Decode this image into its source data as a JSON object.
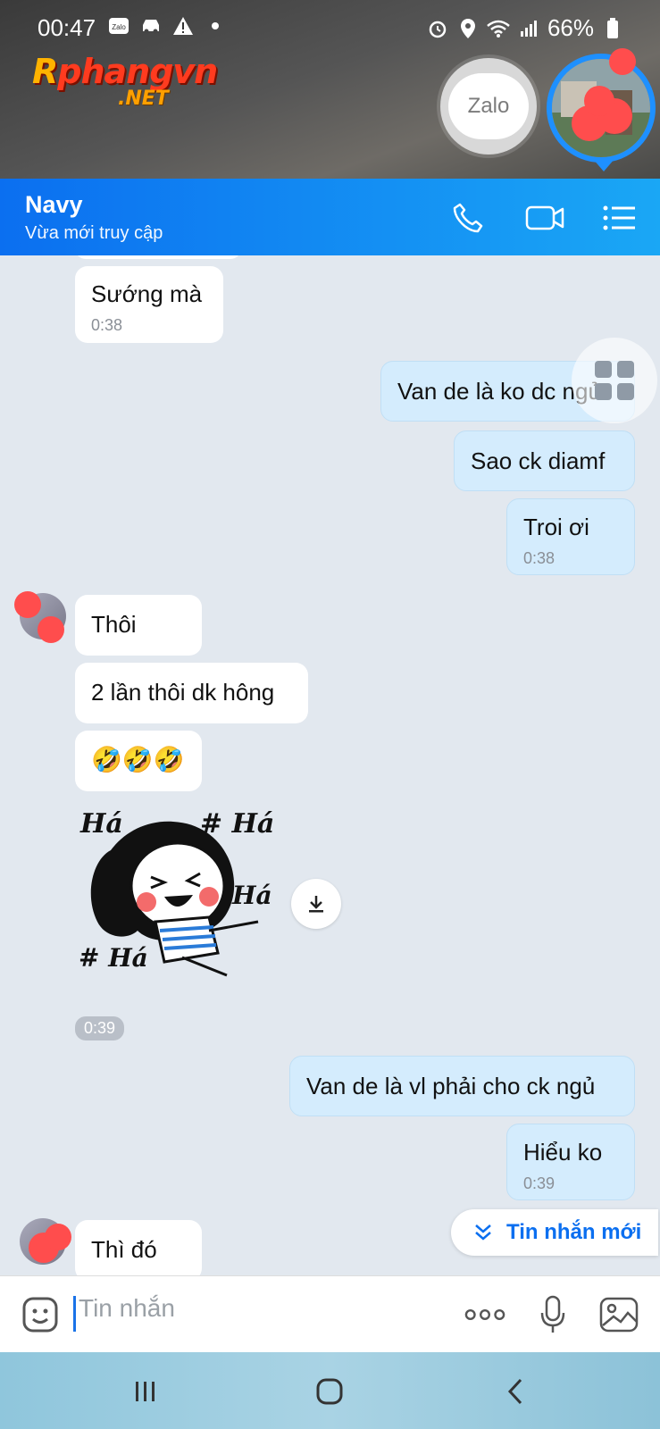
{
  "status_bar": {
    "time": "00:47",
    "battery": "66%",
    "zalo_badge": "Zalo"
  },
  "watermark": {
    "line1a": "R",
    "line1b": "phangvn",
    "line2": ".NET"
  },
  "chat_heads": {
    "zalo_label": "Zalo"
  },
  "header": {
    "name": "Navy",
    "status": "Vừa mới truy cập"
  },
  "messages": [
    {
      "side": "in",
      "text": "Sướng mà",
      "time": "0:38"
    },
    {
      "side": "out",
      "text": "Van de là ko dc ngủ"
    },
    {
      "side": "out",
      "text": "Sao ck diamf"
    },
    {
      "side": "out",
      "text": "Troi ơi",
      "time": "0:38"
    },
    {
      "side": "in",
      "text": "Thôi"
    },
    {
      "side": "in",
      "text": "2 lần thôi dk hông"
    },
    {
      "side": "in",
      "text": "🤣🤣🤣"
    },
    {
      "side": "in",
      "type": "sticker",
      "time": "0:39",
      "sticker_text": [
        "Há",
        "# Há",
        "Há",
        "# Há"
      ]
    },
    {
      "side": "out",
      "text": "Van de là vl phải cho ck ngủ"
    },
    {
      "side": "out",
      "text": "Hiểu ko",
      "time": "0:39"
    },
    {
      "side": "in",
      "text": "Thì đó"
    }
  ],
  "new_message_button": "Tin nhắn mới",
  "composer": {
    "placeholder": "Tin nhắn"
  },
  "colors": {
    "header_start": "#0b6ff0",
    "header_end": "#1aa7f5",
    "outgoing_bubble": "#d4ecfd",
    "incoming_bubble": "#ffffff",
    "accent": "#0b6ff0"
  }
}
